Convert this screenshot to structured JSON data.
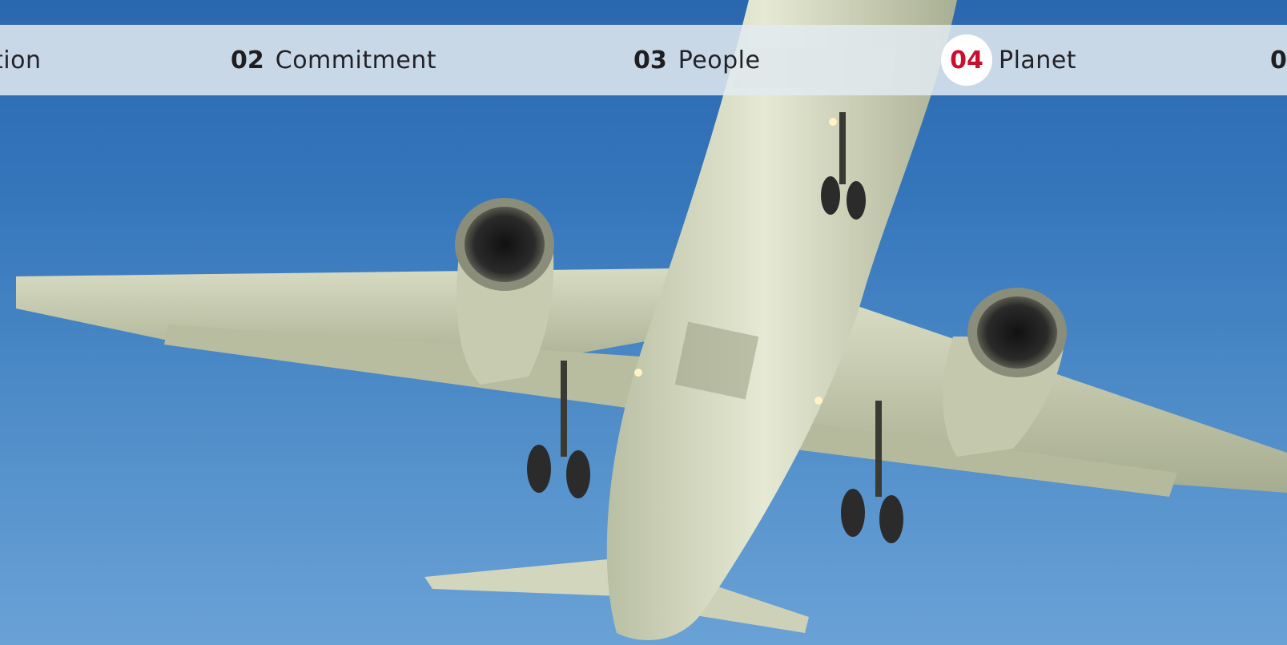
{
  "hero": {
    "image": "airplane-underside-against-blue-sky",
    "colors": {
      "sky_top": "#2a67ae",
      "sky_bottom": "#6aa2d6",
      "fuselage": "#d9ddc4"
    }
  },
  "nav": {
    "items": [
      {
        "num": "",
        "label": "tion"
      },
      {
        "num": "02",
        "label": "Commitment"
      },
      {
        "num": "03",
        "label": "People"
      },
      {
        "num": "04",
        "label": "Planet",
        "active": true
      },
      {
        "num": "0",
        "label": ""
      }
    ],
    "colors": {
      "bar_bg": "#e2eaf0",
      "active_num": "#c8102e",
      "active_circle": "#ffffff",
      "text": "#222226"
    }
  }
}
